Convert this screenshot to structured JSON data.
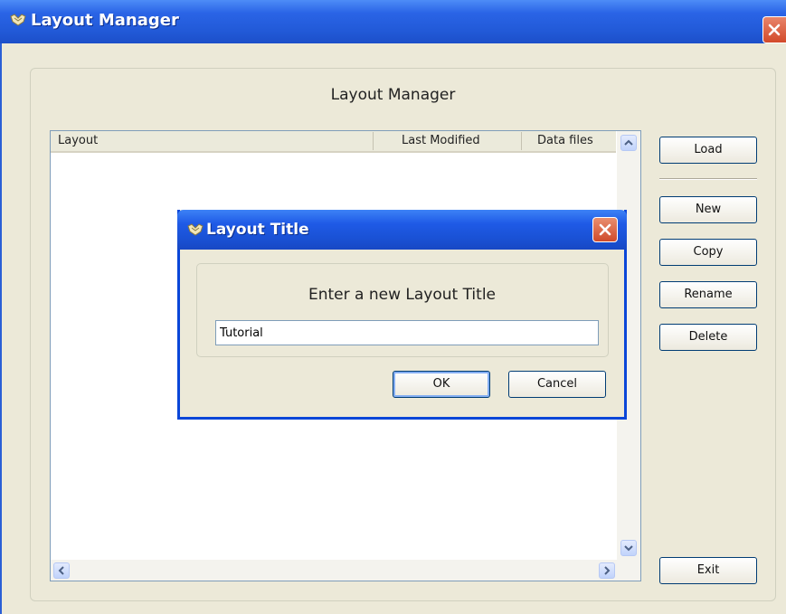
{
  "window": {
    "title": "Layout Manager",
    "heading": "Layout Manager"
  },
  "icons": {
    "app": "app-logo-icon",
    "close": "close-icon",
    "scroll_up": "chevron-up-icon",
    "scroll_down": "chevron-down-icon",
    "scroll_left": "chevron-left-icon",
    "scroll_right": "chevron-right-icon"
  },
  "table": {
    "columns": [
      "Layout",
      "Last Modified",
      "Data files"
    ],
    "rows": []
  },
  "buttons": {
    "load": "Load",
    "new": "New",
    "copy": "Copy",
    "rename": "Rename",
    "delete": "Delete",
    "exit": "Exit"
  },
  "dialog": {
    "title": "Layout Title",
    "prompt": "Enter a new Layout Title",
    "input_value": "Tutorial",
    "ok": "OK",
    "cancel": "Cancel"
  },
  "colors": {
    "titlebar": "#225ad8",
    "close": "#d24a2a",
    "window_bg": "#ece9d8"
  }
}
